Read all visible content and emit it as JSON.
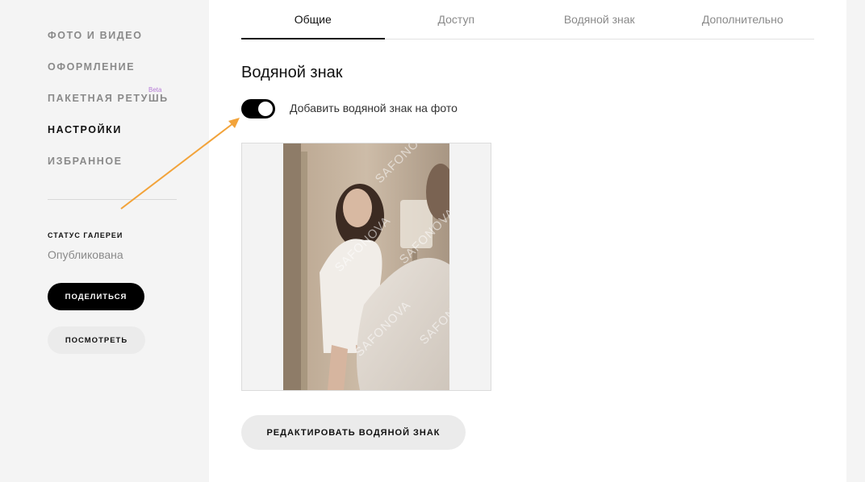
{
  "sidebar": {
    "items": [
      {
        "label": "ФОТО И ВИДЕО",
        "active": false
      },
      {
        "label": "ОФОРМЛЕНИЕ",
        "active": false
      },
      {
        "label": "ПАКЕТНАЯ РЕТУШЬ",
        "active": false,
        "badge": "Beta"
      },
      {
        "label": "НАСТРОЙКИ",
        "active": true
      },
      {
        "label": "ИЗБРАННОЕ",
        "active": false
      }
    ],
    "status_title": "СТАТУС ГАЛЕРЕИ",
    "status_value": "Опубликована",
    "share_label": "ПОДЕЛИТЬСЯ",
    "view_label": "ПОСМОТРЕТЬ"
  },
  "tabs": [
    {
      "label": "Общие",
      "active": true
    },
    {
      "label": "Доступ",
      "active": false
    },
    {
      "label": "Водяной знак",
      "active": false
    },
    {
      "label": "Дополнительно",
      "active": false
    }
  ],
  "watermark": {
    "section_title": "Водяной знак",
    "toggle_label": "Добавить водяной знак на фото",
    "toggle_on": true,
    "preview_text": "SAFONOVA",
    "edit_button": "РЕДАКТИРОВАТЬ ВОДЯНОЙ ЗНАК"
  },
  "colors": {
    "accent_arrow": "#f2a33a",
    "beta": "#b57bd6"
  }
}
